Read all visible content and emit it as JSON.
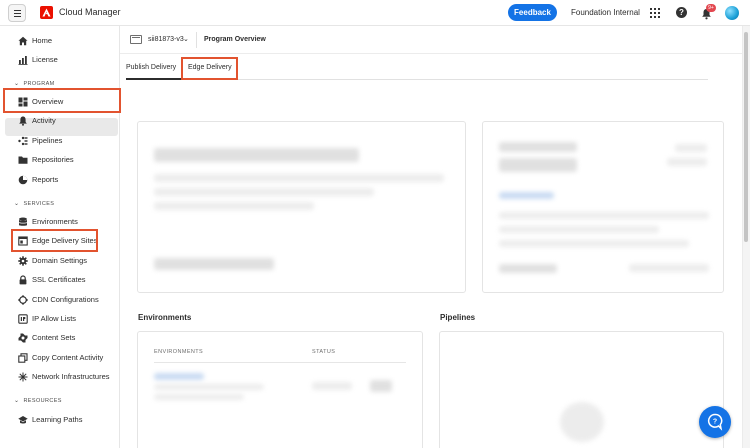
{
  "topbar": {
    "app_title": "Cloud Manager",
    "feedback_label": "Feedback",
    "org_name": "Foundation Internal",
    "notification_count": "9+"
  },
  "sidebar": {
    "items_top": [
      {
        "label": "Home",
        "icon": "home-icon"
      },
      {
        "label": "License",
        "icon": "license-icon"
      }
    ],
    "program_heading": "PROGRAM",
    "program_items": [
      {
        "label": "Overview",
        "icon": "overview-icon",
        "selected": true
      },
      {
        "label": "Activity",
        "icon": "bell-icon"
      },
      {
        "label": "Pipelines",
        "icon": "pipelines-icon"
      },
      {
        "label": "Repositories",
        "icon": "folder-icon"
      },
      {
        "label": "Reports",
        "icon": "reports-icon"
      }
    ],
    "services_heading": "SERVICES",
    "services_items": [
      {
        "label": "Environments",
        "icon": "database-icon"
      },
      {
        "label": "Edge Delivery Sites",
        "icon": "window-icon"
      },
      {
        "label": "Domain Settings",
        "icon": "gear-icon"
      },
      {
        "label": "SSL Certificates",
        "icon": "lock-icon"
      },
      {
        "label": "CDN Configurations",
        "icon": "cdn-icon"
      },
      {
        "label": "IP Allow Lists",
        "icon": "ip-icon"
      },
      {
        "label": "Content Sets",
        "icon": "content-sets-icon"
      },
      {
        "label": "Copy Content Activity",
        "icon": "copy-icon"
      },
      {
        "label": "Network Infrastructures",
        "icon": "network-icon"
      }
    ],
    "resources_heading": "RESOURCES",
    "resources_items": [
      {
        "label": "Learning Paths",
        "icon": "learning-icon"
      }
    ]
  },
  "main": {
    "program_name": "sii81873-v3",
    "page_title": "Program Overview",
    "tabs": [
      {
        "label": "Publish Delivery",
        "active": true
      },
      {
        "label": "Edge Delivery",
        "active": false
      }
    ],
    "environments_title": "Environments",
    "environments_columns": [
      "ENVIRONMENTS",
      "STATUS"
    ],
    "pipelines_title": "Pipelines"
  },
  "colors": {
    "accent": "#1473e6",
    "highlight": "#e2532f",
    "brand": "#eb1000"
  }
}
